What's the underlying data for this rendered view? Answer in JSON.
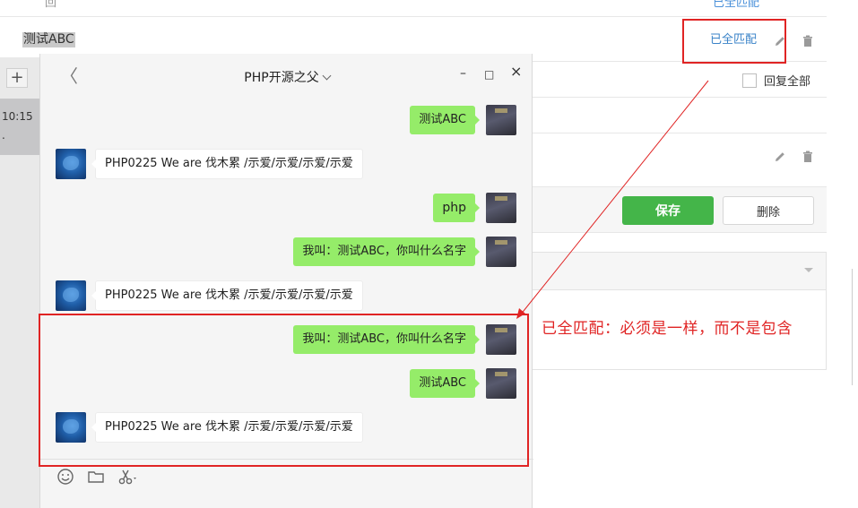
{
  "background_page": {
    "top_partial_text": "回",
    "top_partial_link": "已全匹配",
    "keyword_row_text": "测试ABC",
    "keyword_row_match": "已全匹配",
    "reply_all_label": "回复全部",
    "save_label": "保存",
    "delete_label": "删除"
  },
  "sidebar": {
    "add_label": "+",
    "time": "10:15",
    "dot": "."
  },
  "chat": {
    "title": "PHP开源之父",
    "back_glyph": "〈",
    "minimize_glyph": "–",
    "maximize_glyph": "□",
    "close_glyph": "×",
    "messages": [
      {
        "from": "me",
        "text": "测试ABC"
      },
      {
        "from": "bot",
        "text": "PHP0225   We   are   伐木累  /示爱/示爱/示爱/示爱"
      },
      {
        "from": "me",
        "text": "php"
      },
      {
        "from": "me",
        "text": "我叫：测试ABC，你叫什么名字"
      },
      {
        "from": "bot",
        "text": "PHP0225   We   are   伐木累  /示爱/示爱/示爱/示爱"
      },
      {
        "from": "me",
        "text": "我叫：测试ABC，你叫什么名字"
      },
      {
        "from": "me",
        "text": "测试ABC"
      },
      {
        "from": "bot",
        "text": "PHP0225   We   are   伐木累  /示爱/示爱/示爱/示爱"
      }
    ],
    "tools": [
      "emoji-icon",
      "folder-icon",
      "scissors-icon"
    ]
  },
  "annotation": {
    "text": "已全匹配：必须是一样，而不是包含",
    "color": "#e02424"
  },
  "colors": {
    "accent_green": "#44b549",
    "bubble_green": "#95ec69",
    "link_blue": "#3a83c8"
  }
}
